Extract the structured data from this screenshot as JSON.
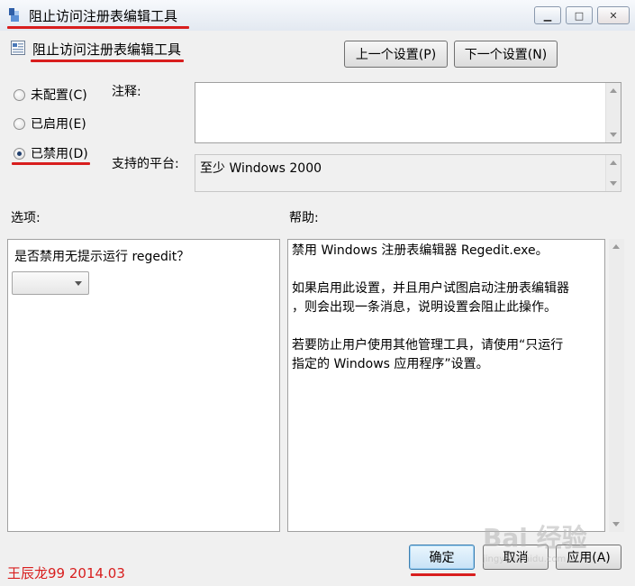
{
  "window": {
    "title": "阻止访问注册表编辑工具",
    "min_glyph": "▁",
    "max_glyph": "□",
    "close_glyph": "✕"
  },
  "header": {
    "policy_title": "阻止访问注册表编辑工具",
    "prev_button": "上一个设置(P)",
    "next_button": "下一个设置(N)"
  },
  "state": {
    "options": [
      {
        "label": "未配置(C)",
        "checked": false
      },
      {
        "label": "已启用(E)",
        "checked": false
      },
      {
        "label": "已禁用(D)",
        "checked": true
      }
    ]
  },
  "comment": {
    "label": "注释:",
    "value": ""
  },
  "platform": {
    "label": "支持的平台:",
    "value": "至少 Windows 2000"
  },
  "options_pane": {
    "label": "选项:",
    "question": "是否禁用无提示运行 regedit？",
    "combo_value": ""
  },
  "help_pane": {
    "label": "帮助:",
    "lines": [
      "禁用 Windows 注册表编辑器 Regedit.exe。",
      "",
      "如果启用此设置，并且用户试图启动注册表编辑器",
      "，则会出现一条消息，说明设置会阻止此操作。",
      "",
      "若要防止用户使用其他管理工具，请使用“只运行",
      "指定的 Windows 应用程序”设置。"
    ]
  },
  "footer": {
    "ok": "确定",
    "cancel": "取消",
    "apply": "应用(A)",
    "author_note": "王辰龙99 2014.03"
  },
  "watermark": {
    "text": "Bai 经验",
    "sub": "jingyan.baidu.com"
  },
  "colors": {
    "annotation_red": "#d81e1e",
    "accent_blue": "#3c7fb1"
  }
}
